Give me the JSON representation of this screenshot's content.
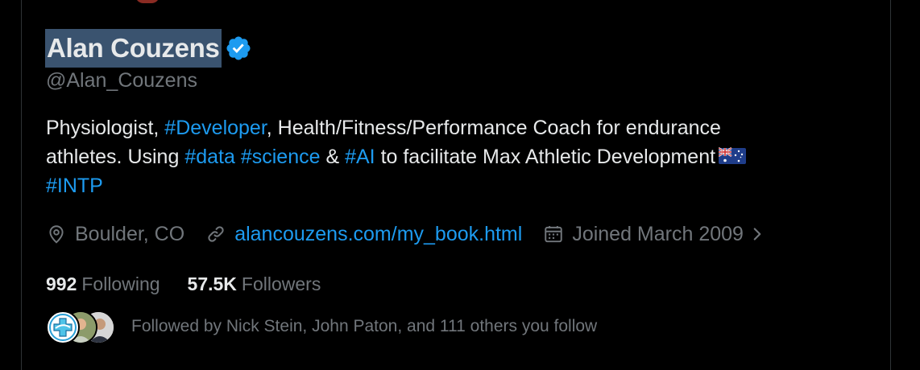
{
  "profile": {
    "display_name": "Alan Couzens",
    "handle": "@Alan_Couzens",
    "verified": true,
    "bio": {
      "line1_a": "Physiologist, ",
      "line1_tag": "#Developer",
      "line1_b": ", Health/Fitness/Performance Coach for endurance",
      "line2_a": "athletes. Using ",
      "line2_tag1": "#data",
      "line2_sp": " ",
      "line2_tag2": "#science",
      "line2_amp": " & ",
      "line2_tag3": "#AI",
      "line2_b": " to facilitate Max Athletic Development",
      "line3_tag": "#INTP"
    },
    "location": "Boulder, CO",
    "website": "alancouzens.com/my_book.html",
    "joined": "Joined March 2009",
    "following_count": "992",
    "following_label": "Following",
    "followers_count": "57.5K",
    "followers_label": "Followers",
    "followed_by": "Followed by Nick Stein, John Paton, and 111 others you follow"
  },
  "icons": {
    "verified": "verified-badge-icon",
    "location": "location-pin-icon",
    "link": "link-icon",
    "calendar": "calendar-icon",
    "chevron": "chevron-right-icon",
    "flag": "australia-flag-icon"
  },
  "colors": {
    "background": "#000000",
    "text_primary": "#e7e9ea",
    "text_secondary": "#71767b",
    "accent": "#1d9bf0",
    "name_highlight": "#3a536f"
  }
}
